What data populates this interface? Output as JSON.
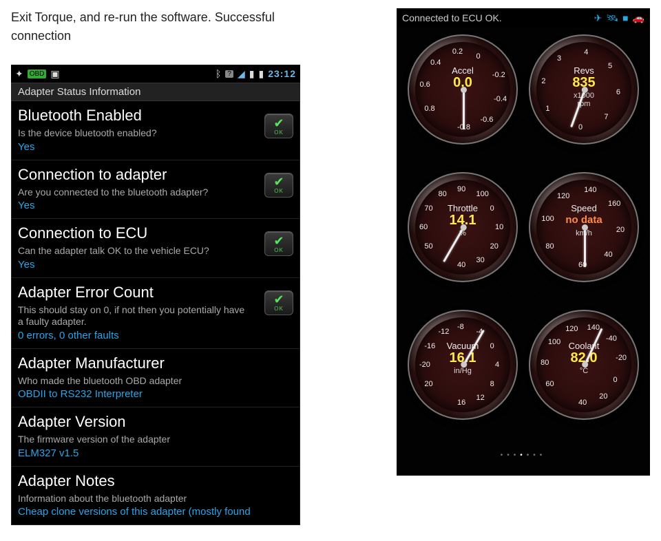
{
  "caption_line1": "Exit Torque, and re-run the software. Successful",
  "caption_line2": "connection",
  "left_phone": {
    "statusbar": {
      "clock": "23:12"
    },
    "section_header": "Adapter Status Information",
    "items": [
      {
        "title": "Bluetooth Enabled",
        "desc": "Is the device bluetooth enabled?",
        "value": "Yes",
        "ok": true
      },
      {
        "title": "Connection to adapter",
        "desc": "Are you connected to the bluetooth adapter?",
        "value": "Yes",
        "ok": true
      },
      {
        "title": "Connection to ECU",
        "desc": "Can the adapter talk OK to the vehicle ECU?",
        "value": "Yes",
        "ok": true
      },
      {
        "title": "Adapter Error Count",
        "desc": "This should stay on 0, if not then you potentially have a faulty adapter.",
        "value": "0 errors, 0 other faults",
        "ok": true
      },
      {
        "title": "Adapter Manufacturer",
        "desc": "Who made the bluetooth OBD adapter",
        "value": "OBDII to RS232 Interpreter",
        "ok": false
      },
      {
        "title": "Adapter Version",
        "desc": "The firmware version of the adapter",
        "value": "ELM327 v1.5",
        "ok": false
      },
      {
        "title": "Adapter Notes",
        "desc": "Information about the bluetooth adapter",
        "value": "Cheap clone versions of this adapter (mostly found",
        "ok": false
      }
    ],
    "ok_label": "OK"
  },
  "right_phone": {
    "status_text": "Connected to ECU OK.",
    "gauges": [
      {
        "name": "Accel",
        "value": "0.0",
        "unit": "",
        "ticks": [
          "0.8",
          "0.6",
          "0.4",
          "0.2",
          "0",
          "-0.2",
          "-0.4",
          "-0.6",
          "-0.8"
        ],
        "needle_deg": 180,
        "nodata": false
      },
      {
        "name": "Revs",
        "value": "835",
        "unit": "x1000\nrpm",
        "ticks": [
          "1",
          "2",
          "3",
          "4",
          "5",
          "6",
          "7",
          "0"
        ],
        "needle_deg": 200,
        "nodata": false
      },
      {
        "name": "Throttle",
        "value": "14.1",
        "unit": "%",
        "ticks": [
          "50",
          "60",
          "70",
          "80",
          "90",
          "100",
          "0",
          "10",
          "20",
          "30",
          "40"
        ],
        "needle_deg": -150,
        "nodata": false
      },
      {
        "name": "Speed",
        "value": "no data",
        "unit": "km/h",
        "ticks": [
          "80",
          "100",
          "120",
          "140",
          "160",
          "20",
          "40",
          "60"
        ],
        "needle_deg": 180,
        "nodata": true
      },
      {
        "name": "Vacuum",
        "value": "16.1",
        "unit": "in/Hg",
        "ticks": [
          "20",
          "-20",
          "-16",
          "-12",
          "-8",
          "-4",
          "0",
          "4",
          "8",
          "12",
          "16"
        ],
        "needle_deg": 30,
        "nodata": false
      },
      {
        "name": "Coolant",
        "value": "82.0",
        "unit": "°C",
        "ticks": [
          "60",
          "80",
          "100",
          "120",
          "140",
          "-40",
          "-20",
          "0",
          "20",
          "40"
        ],
        "needle_deg": 25,
        "nodata": false
      }
    ]
  }
}
